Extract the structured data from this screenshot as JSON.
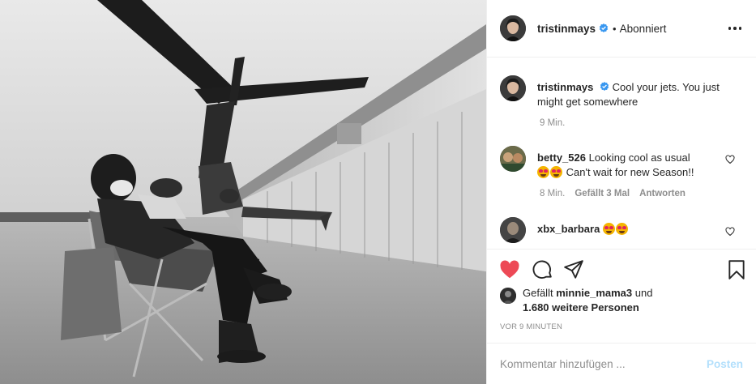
{
  "header": {
    "username": "tristinmays",
    "separator": "•",
    "follow_status": "Abonniert"
  },
  "caption": {
    "username": "tristinmays",
    "text": "Cool your jets. You just might get somewhere",
    "time": "9 Min."
  },
  "comments": [
    {
      "username": "betty_526",
      "text_before": "Looking cool as usual",
      "text_after": "Can't wait for new Season!!",
      "time": "8 Min.",
      "likes": "Gefällt 3 Mal",
      "reply": "Antworten"
    },
    {
      "username": "xbx_barbara"
    }
  ],
  "likes": {
    "prefix": "Gefällt",
    "user": "minnie_mama3",
    "connector": "und",
    "others": "1.680 weitere Personen"
  },
  "timestamp": "VOR 9 MINUTEN",
  "comment_box": {
    "placeholder": "Kommentar hinzufügen ...",
    "post_label": "Posten"
  },
  "icons": {
    "like": "heart-filled-icon",
    "comment": "comment-bubble-icon",
    "share": "paper-plane-icon",
    "save": "bookmark-icon",
    "verified": "verified-badge-icon",
    "more": "more-options-icon"
  },
  "colors": {
    "like_red": "#ed4956",
    "verified_blue": "#3897f0",
    "post_button_disabled": "#b2dffc",
    "text_secondary": "#8e8e8e"
  }
}
